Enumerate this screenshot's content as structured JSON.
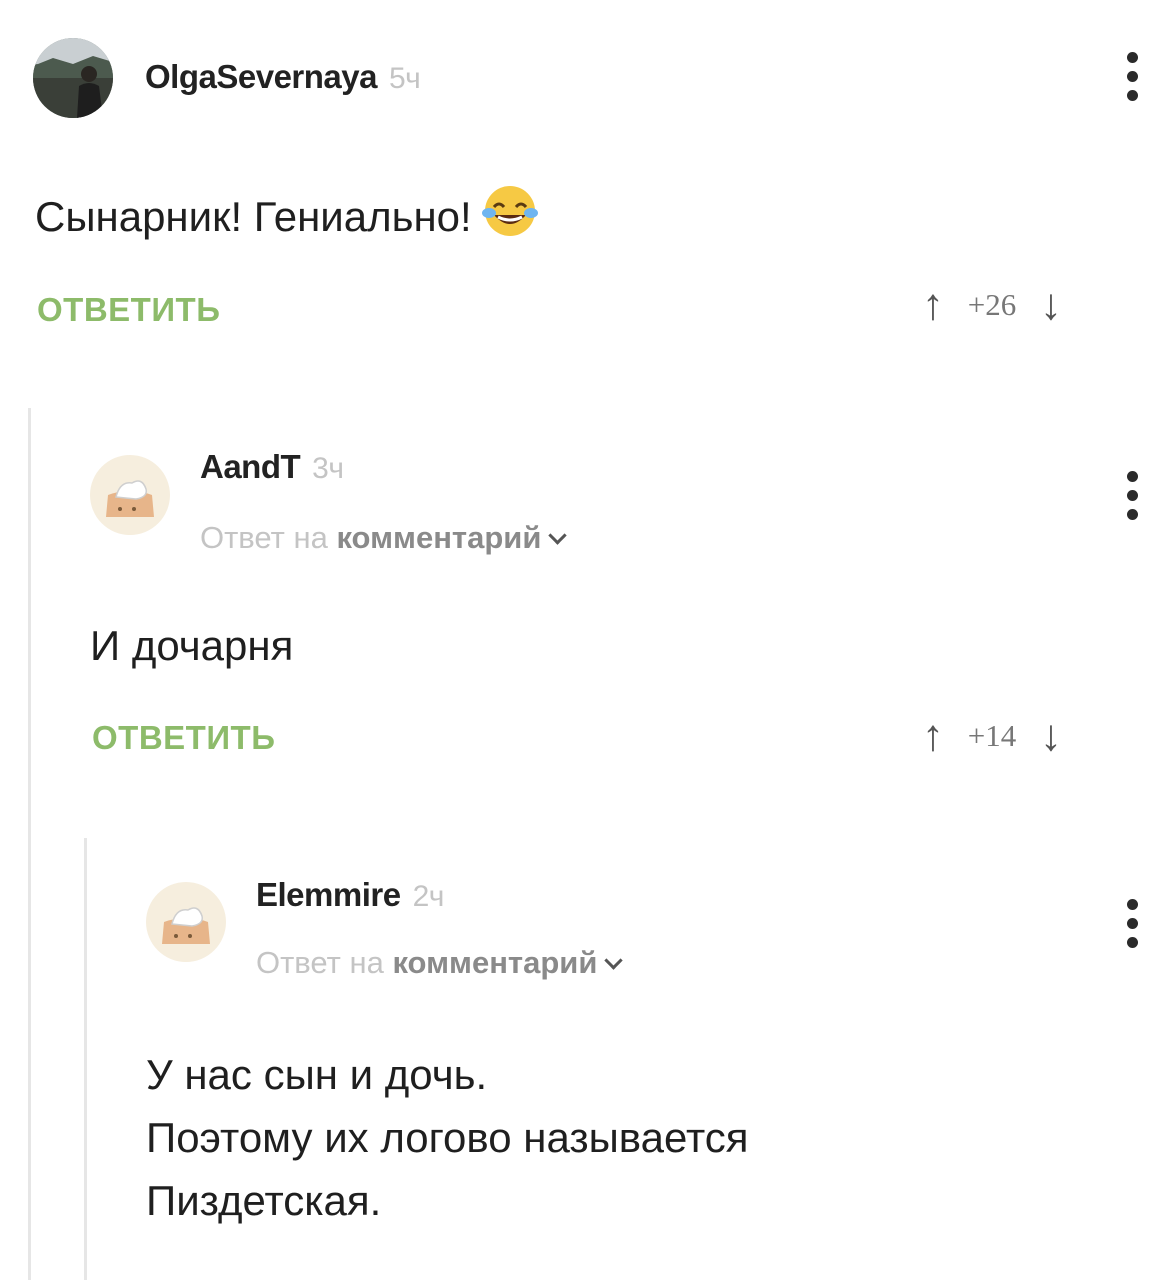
{
  "comments": [
    {
      "author": "OlgaSevernaya",
      "time": "5ч",
      "lines": [
        "Сынарник! Гениально!"
      ],
      "emoji": "face-with-tears-of-joy",
      "reply_label": "ОТВЕТИТЬ",
      "score": "+26"
    },
    {
      "author": "AandT",
      "time": "3ч",
      "reply_prefix": "Ответ на",
      "reply_target": "комментарий",
      "lines": [
        "И дочарня"
      ],
      "reply_label": "ОТВЕТИТЬ",
      "score": "+14"
    },
    {
      "author": "Elemmire",
      "time": "2ч",
      "reply_prefix": "Ответ на",
      "reply_target": "комментарий",
      "lines": [
        "У нас сын и дочь.",
        "Поэтому их логово называется",
        "Пиздетская."
      ]
    }
  ],
  "icons": {
    "upvote": "↑",
    "downvote": "↓",
    "more": "more-vertical-icon"
  },
  "colors": {
    "reply_green": "#8dbb6a",
    "time_gray": "#c4c4c4",
    "thread_line": "#e6e6e6"
  }
}
